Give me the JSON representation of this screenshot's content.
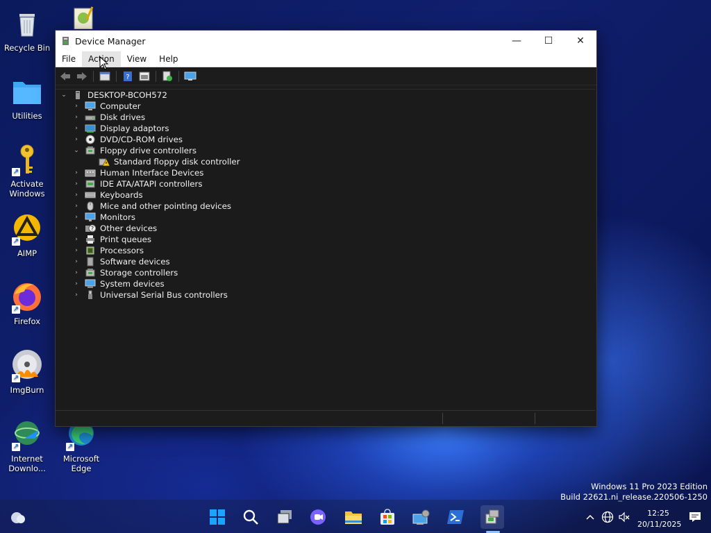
{
  "desktop": {
    "icons": [
      {
        "label": "Recycle Bin",
        "icon": "recycle-bin-icon"
      },
      {
        "label": "Utilities",
        "icon": "folder-icon"
      },
      {
        "label": "Activate Windows",
        "icon": "key-icon"
      },
      {
        "label": "AIMP",
        "icon": "aimp-icon"
      },
      {
        "label": "Firefox",
        "icon": "firefox-icon"
      },
      {
        "label": "ImgBurn",
        "icon": "imgburn-icon"
      },
      {
        "label": "Internet Downlo...",
        "icon": "internet-download-manager-icon"
      },
      {
        "label": "Microsoft Edge",
        "icon": "edge-icon"
      }
    ]
  },
  "window": {
    "title": "Device Manager",
    "menu": [
      "File",
      "Action",
      "View",
      "Help"
    ],
    "tree": {
      "root": "DESKTOP-BCOH572",
      "categories": [
        {
          "label": "Computer",
          "expanded": false
        },
        {
          "label": "Disk drives",
          "expanded": false
        },
        {
          "label": "Display adaptors",
          "expanded": false
        },
        {
          "label": "DVD/CD-ROM drives",
          "expanded": false
        },
        {
          "label": "Floppy drive controllers",
          "expanded": true,
          "children": [
            "Standard floppy disk controller"
          ]
        },
        {
          "label": "Human Interface Devices",
          "expanded": false
        },
        {
          "label": "IDE ATA/ATAPI controllers",
          "expanded": false
        },
        {
          "label": "Keyboards",
          "expanded": false
        },
        {
          "label": "Mice and other pointing devices",
          "expanded": false
        },
        {
          "label": "Monitors",
          "expanded": false
        },
        {
          "label": "Other devices",
          "expanded": false
        },
        {
          "label": "Print queues",
          "expanded": false
        },
        {
          "label": "Processors",
          "expanded": false
        },
        {
          "label": "Software devices",
          "expanded": false
        },
        {
          "label": "Storage controllers",
          "expanded": false
        },
        {
          "label": "System devices",
          "expanded": false
        },
        {
          "label": "Universal Serial Bus controllers",
          "expanded": false
        }
      ]
    }
  },
  "watermark": {
    "line1": "Windows 11 Pro 2023 Edition",
    "line2": "Build 22621.ni_release.220506-1250"
  },
  "tray": {
    "time": "12:25",
    "date": "20/11/2025"
  },
  "colors": {
    "accent": "#0078d4",
    "window_bg": "#1c1c1c",
    "titlebar_bg": "#ffffff"
  }
}
